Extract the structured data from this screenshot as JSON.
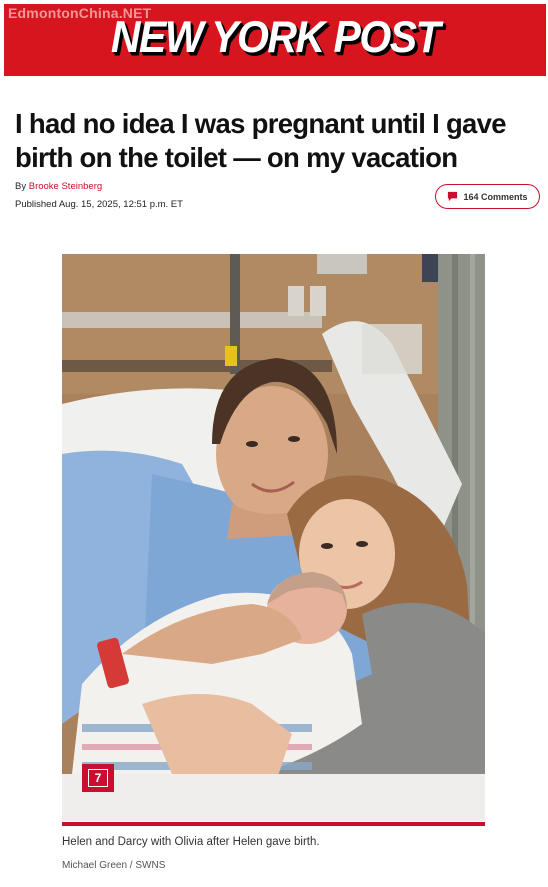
{
  "masthead": {
    "watermark": "EdmontonChina.NET",
    "logo": "NEW YORK POST"
  },
  "article": {
    "headline": "I had no idea I was pregnant until I gave birth on the toilet — on my vacation",
    "byline_prefix": "By",
    "author": "Brooke Steinberg",
    "published": "Published Aug. 15, 2025, 12:51 p.m. ET",
    "comments_label": "164 Comments"
  },
  "photo": {
    "badge": "7",
    "caption": "Helen and Darcy with Olivia after Helen gave birth.",
    "credit": "Michael Green / SWNS"
  },
  "colors": {
    "brand_red": "#d7151e",
    "link_red": "#c8102e"
  }
}
